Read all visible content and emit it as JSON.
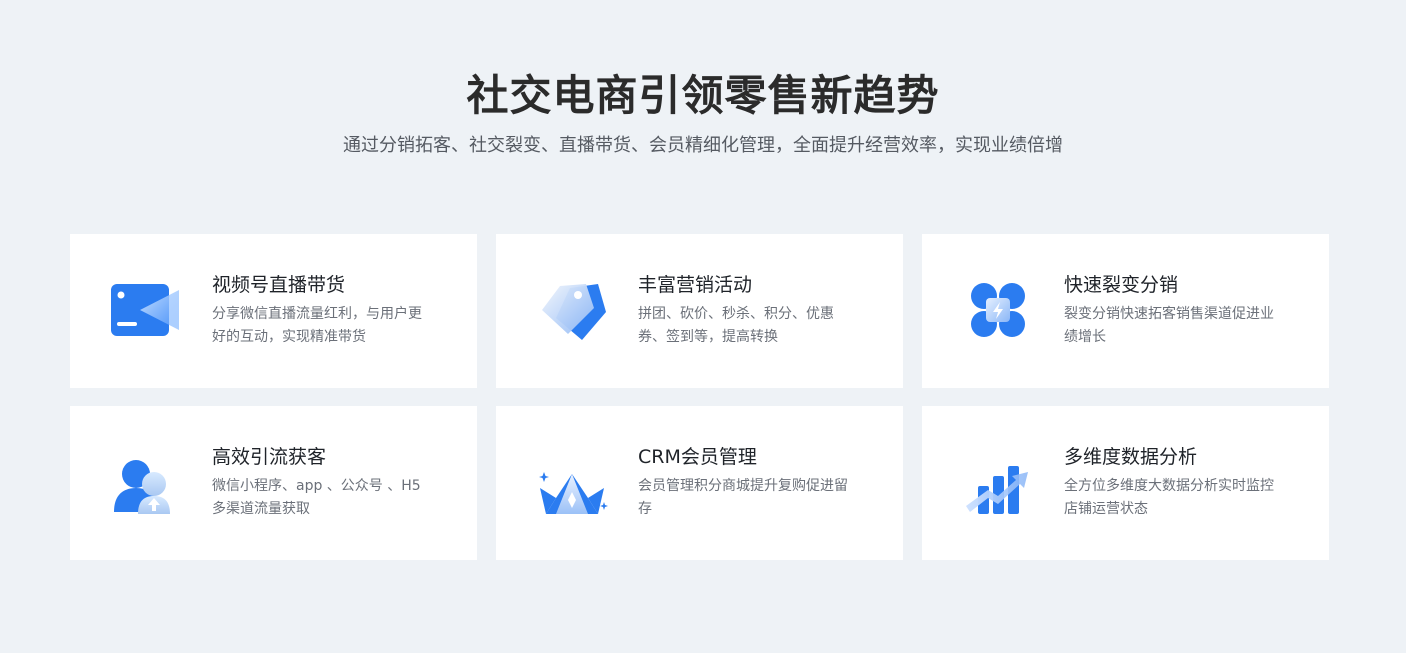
{
  "hero": {
    "title": "社交电商引领零售新趋势",
    "subtitle": "通过分销拓客、社交裂变、直播带货、会员精细化管理，全面提升经营效率，实现业绩倍增"
  },
  "colors": {
    "page_bg": "#eef2f6",
    "card_bg": "#ffffff",
    "accent_blue": "#2b7cf0",
    "title_text": "#2b2b2b",
    "desc_text": "#6b7079"
  },
  "cards": [
    {
      "icon": "video-live-icon",
      "title": "视频号直播带货",
      "desc": "分享微信直播流量红利，与用户更好的互动，实现精准带货"
    },
    {
      "icon": "price-tag-icon",
      "title": "丰富营销活动",
      "desc": "拼团、砍价、秒杀、积分、优惠券、签到等，提高转换"
    },
    {
      "icon": "fission-network-icon",
      "title": "快速裂变分销",
      "desc": "裂变分销快速拓客销售渠道促进业绩增长"
    },
    {
      "icon": "user-growth-icon",
      "title": "高效引流获客",
      "desc": "微信小程序、app 、公众号 、H5多渠道流量获取"
    },
    {
      "icon": "crown-icon",
      "title": "CRM会员管理",
      "desc": "会员管理积分商城提升复购促进留存"
    },
    {
      "icon": "data-chart-icon",
      "title": "多维度数据分析",
      "desc": "全方位多维度大数据分析实时监控店铺运营状态"
    }
  ]
}
